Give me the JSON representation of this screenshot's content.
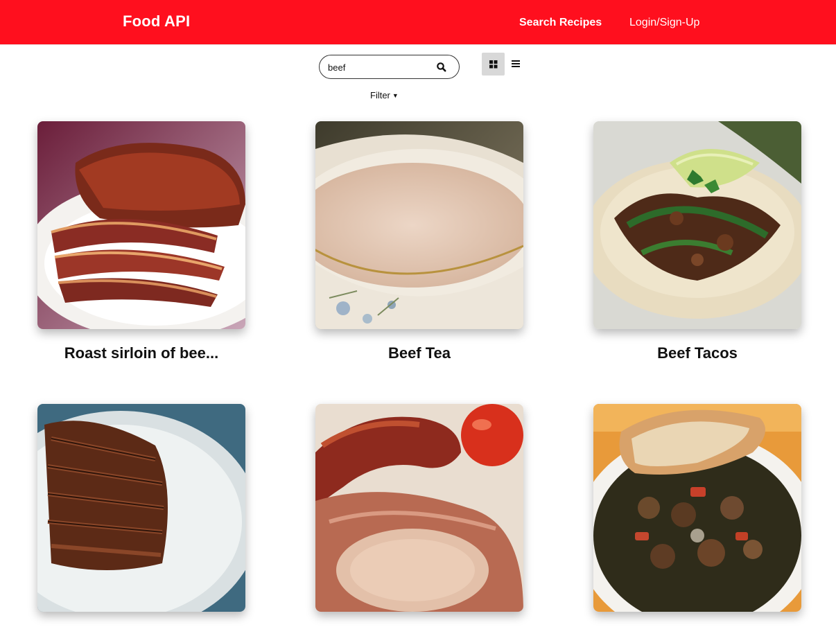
{
  "nav": {
    "brand": "Food API",
    "search_recipes": "Search Recipes",
    "login": "Login/Sign-Up",
    "bg_color": "#ff0f1e"
  },
  "search": {
    "value": "beef",
    "button_icon": "search-icon"
  },
  "view_toggle": {
    "grid_icon": "grid-view-icon",
    "list_icon": "list-view-icon",
    "active": "grid"
  },
  "filter": {
    "label": "Filter",
    "icon": "caret-down-icon"
  },
  "recipes": [
    {
      "title": "Roast sirloin of bee..."
    },
    {
      "title": "Beef Tea"
    },
    {
      "title": "Beef Tacos"
    },
    {
      "title": ""
    },
    {
      "title": ""
    },
    {
      "title": ""
    }
  ]
}
